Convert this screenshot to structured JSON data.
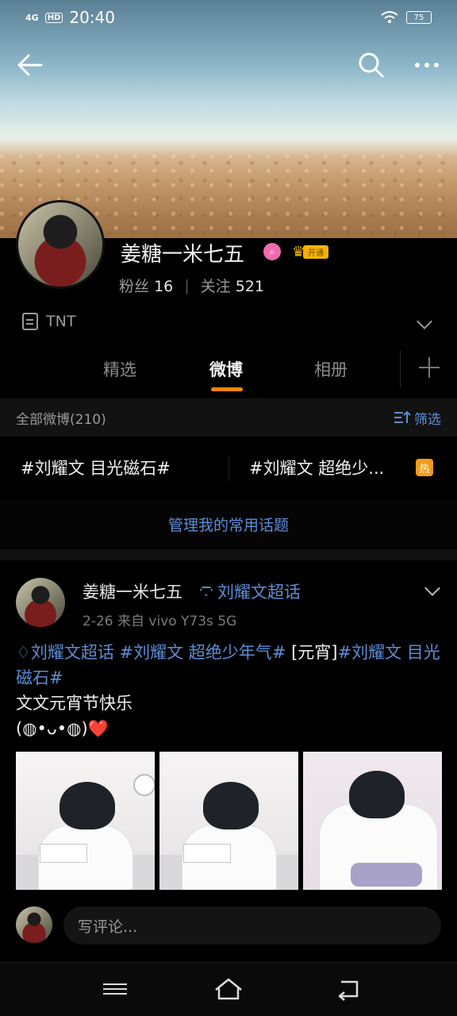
{
  "status_bar": {
    "network": "4G",
    "hd": "HD",
    "time": "20:40",
    "battery": "75"
  },
  "profile": {
    "name": "姜糖一米七五",
    "badge_label": "开通",
    "fans_label": "粉丝",
    "fans_count": "16",
    "follow_label": "关注",
    "follow_count": "521",
    "intro": "TNT"
  },
  "tabs": [
    {
      "label": "精选",
      "active": false
    },
    {
      "label": "微博",
      "active": true
    },
    {
      "label": "相册",
      "active": false
    }
  ],
  "filter": {
    "label": "全部微博(210)",
    "filter_label": "筛选"
  },
  "topics": [
    {
      "label": "#刘耀文 目光磁石#"
    },
    {
      "label": "#刘耀文 超绝少...",
      "hot_label": "热"
    }
  ],
  "manage_label": "管理我的常用话题",
  "post": {
    "user": "姜糖一米七五",
    "supertopic": "刘耀文超话",
    "meta": "2-26  来自 vivo Y73s 5G",
    "body_link1": "刘耀文超话",
    "body_link2": "#刘耀文 超绝少年气#",
    "body_plain1": "[元宵]",
    "body_link3": "#刘耀文 目光磁石#",
    "body_line2": "文文元宵节快乐",
    "body_line3": "(◍•ᴗ•◍)❤️"
  },
  "comment_placeholder": "写评论...",
  "colors": {
    "accent": "#ff8200",
    "link": "#5b8ed6",
    "hot": "#f39a1c"
  }
}
